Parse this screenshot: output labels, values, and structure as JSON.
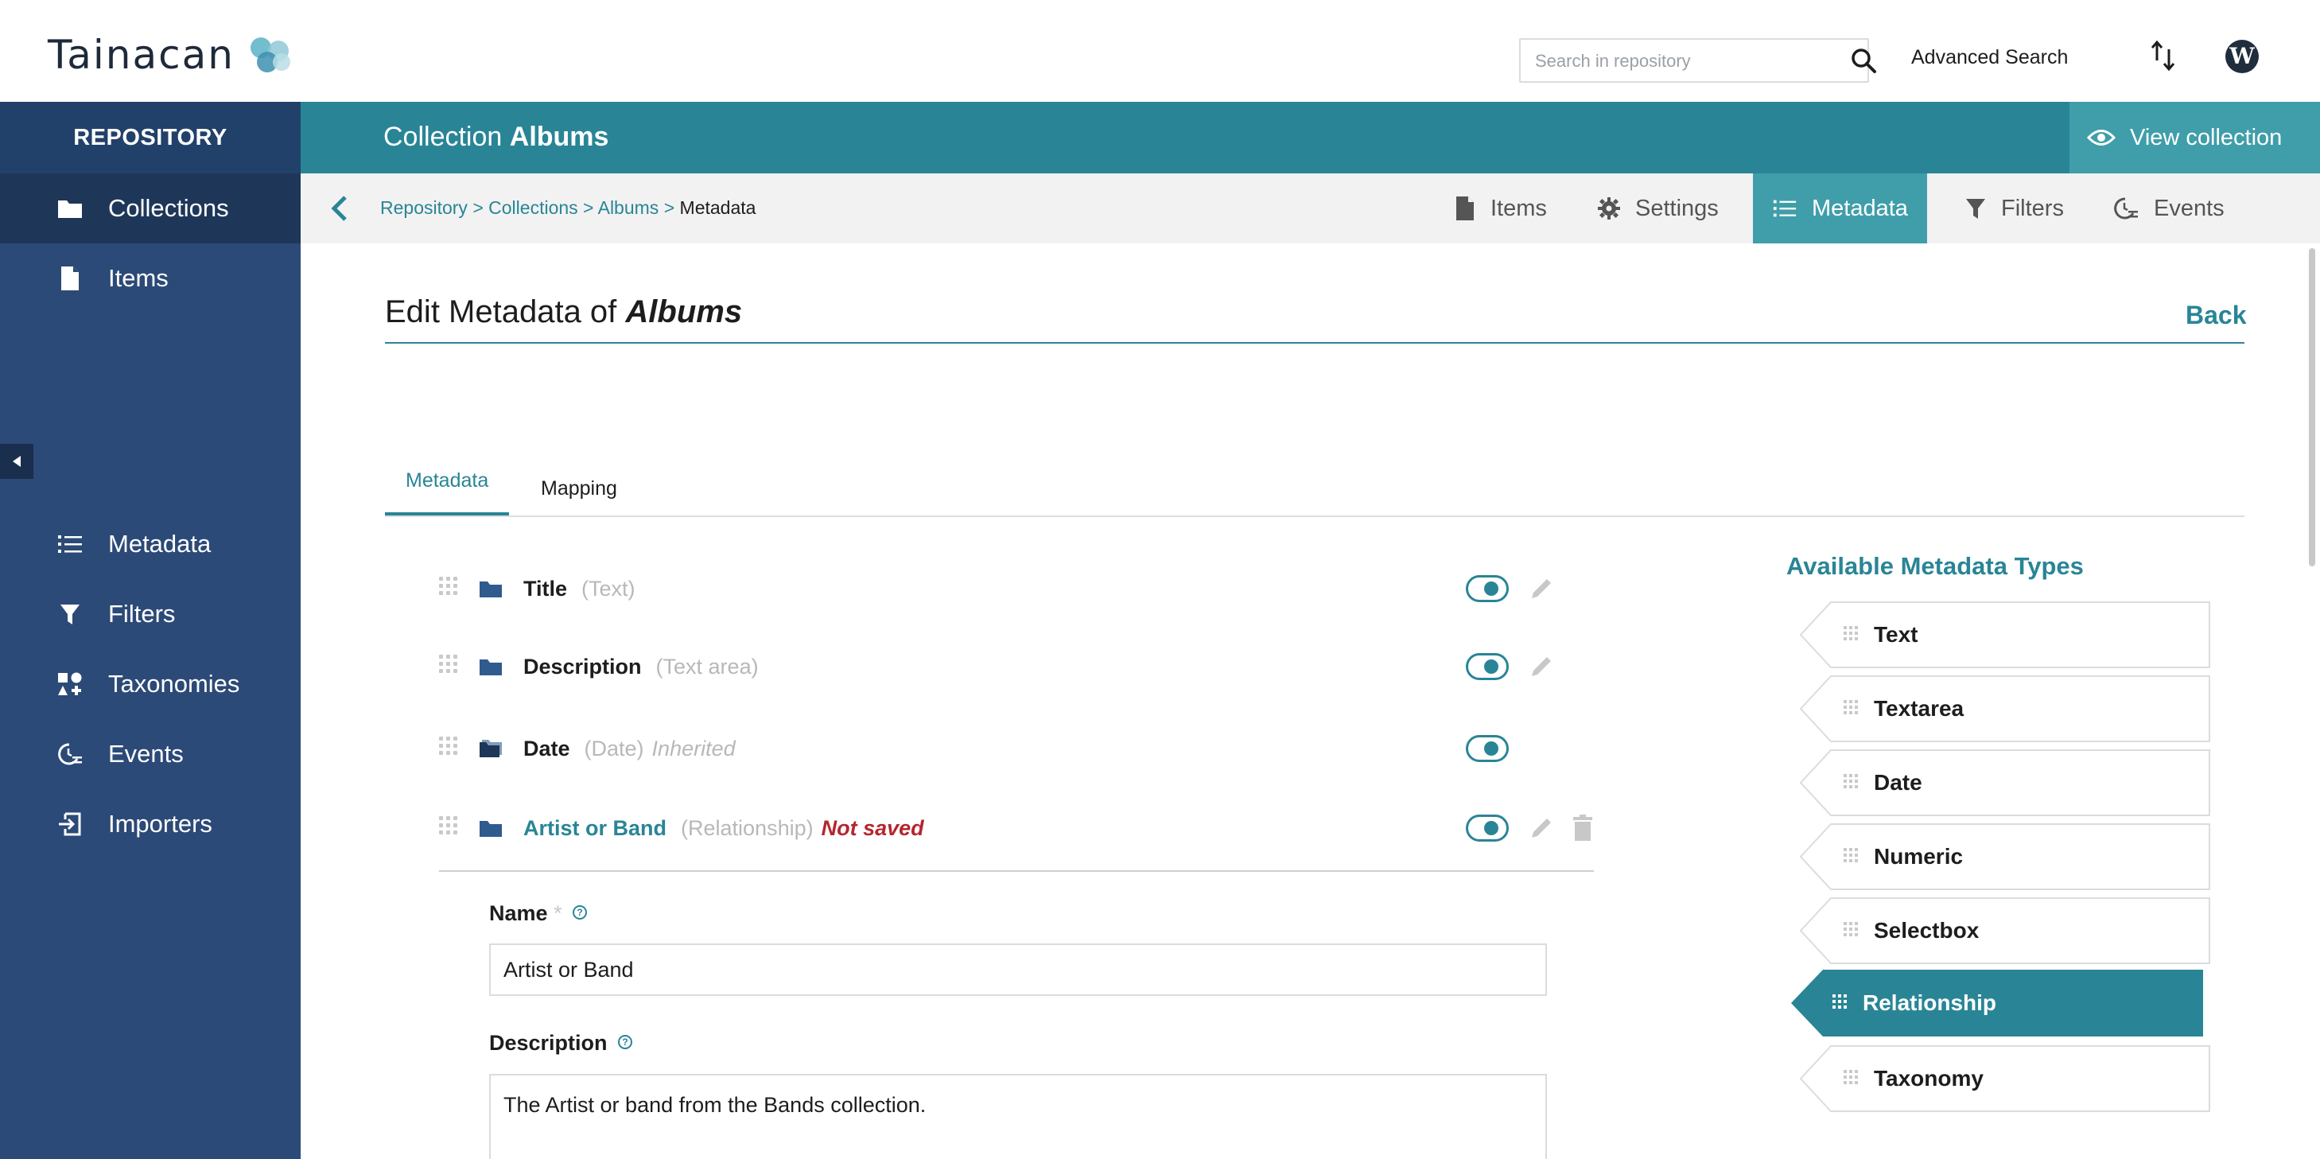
{
  "app": {
    "logo_text": "Tainacan",
    "search_placeholder": "Search in repository",
    "advanced_search": "Advanced Search"
  },
  "sidebar": {
    "header": "REPOSITORY",
    "items": [
      {
        "label": "Collections",
        "icon": "folder-icon"
      },
      {
        "label": "Items",
        "icon": "file-icon"
      },
      {
        "label": "Metadata",
        "icon": "list-icon"
      },
      {
        "label": "Filters",
        "icon": "filter-icon"
      },
      {
        "label": "Taxonomies",
        "icon": "taxonomies-icon"
      },
      {
        "label": "Events",
        "icon": "events-icon"
      },
      {
        "label": "Importers",
        "icon": "import-icon"
      }
    ]
  },
  "collection": {
    "title_prefix": "Collection",
    "title_name": "Albums",
    "view_label": "View collection"
  },
  "breadcrumb": {
    "parts": [
      "Repository",
      "Collections",
      "Albums"
    ],
    "separator": " > ",
    "current": "Metadata"
  },
  "subtabs": [
    {
      "label": "Items",
      "icon": "file-icon"
    },
    {
      "label": "Settings",
      "icon": "gear-icon"
    },
    {
      "label": "Metadata",
      "icon": "list-icon"
    },
    {
      "label": "Filters",
      "icon": "filter-icon"
    },
    {
      "label": "Events",
      "icon": "events-icon"
    }
  ],
  "page": {
    "title_prefix": "Edit Metadata of",
    "title_name": "Albums",
    "back_label": "Back"
  },
  "tabs": {
    "metadata": "Metadata",
    "mapping": "Mapping"
  },
  "metadata": [
    {
      "name": "Title",
      "type": "(Text)"
    },
    {
      "name": "Description",
      "type": "(Text area)"
    },
    {
      "name": "Date",
      "type": "(Date)",
      "inherited": "Inherited"
    },
    {
      "name": "Artist or Band",
      "type": "(Relationship)",
      "status": "Not saved"
    }
  ],
  "form": {
    "name_label": "Name",
    "required_mark": "*",
    "name_value": "Artist or Band",
    "description_label": "Description",
    "description_value": "The Artist or band from the Bands collection."
  },
  "available": {
    "title": "Available Metadata Types",
    "types": [
      "Text",
      "Textarea",
      "Date",
      "Numeric",
      "Selectbox",
      "Relationship",
      "Taxonomy"
    ],
    "active_type": "Relationship"
  },
  "colors": {
    "teal": "#298596",
    "teal_light": "#3f9ea9",
    "sidebar": "#2c4a77",
    "error": "#b5262e"
  }
}
